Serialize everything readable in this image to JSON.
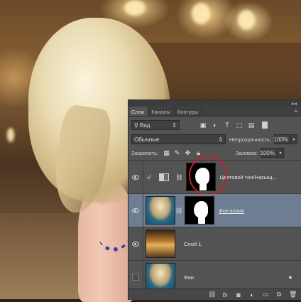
{
  "window": {
    "top_bar_glyph": "◂◂"
  },
  "tabs": [
    {
      "label": "Слои",
      "active": true
    },
    {
      "label": "Каналы",
      "active": false
    },
    {
      "label": "Контуры",
      "active": false
    }
  ],
  "tabs_menu_glyph": "≡",
  "filter": {
    "kind_label": "Вид",
    "icons": [
      "image-filter-icon",
      "adjustment-filter-icon",
      "type-filter-icon",
      "shape-filter-icon",
      "smart-object-filter-icon"
    ]
  },
  "blend": {
    "mode": "Обычные",
    "opacity_label": "Непрозрачность:",
    "opacity_value": "100%"
  },
  "lock": {
    "label": "Закрепить:",
    "fill_label": "Заливка:",
    "fill_value": "100%"
  },
  "layers": [
    {
      "name": "Цветовой тон/Насыщ...",
      "type": "adjustment",
      "visible": true,
      "selected": false
    },
    {
      "name": "Фон копия",
      "type": "image-with-mask",
      "visible": true,
      "selected": true
    },
    {
      "name": "Слой 1",
      "type": "image",
      "visible": true,
      "selected": false
    },
    {
      "name": "Фон",
      "type": "background",
      "visible": false,
      "selected": false,
      "locked": true
    }
  ],
  "bottom_icons": [
    "link-layers-icon",
    "fx-icon",
    "add-mask-icon",
    "new-adjustment-icon",
    "new-group-icon",
    "new-layer-icon",
    "delete-layer-icon"
  ],
  "fx_label": "fx",
  "colors": {
    "panel": "#535353",
    "selected_row": "#6e7d92",
    "highlight_ring": "#c51d2a"
  }
}
